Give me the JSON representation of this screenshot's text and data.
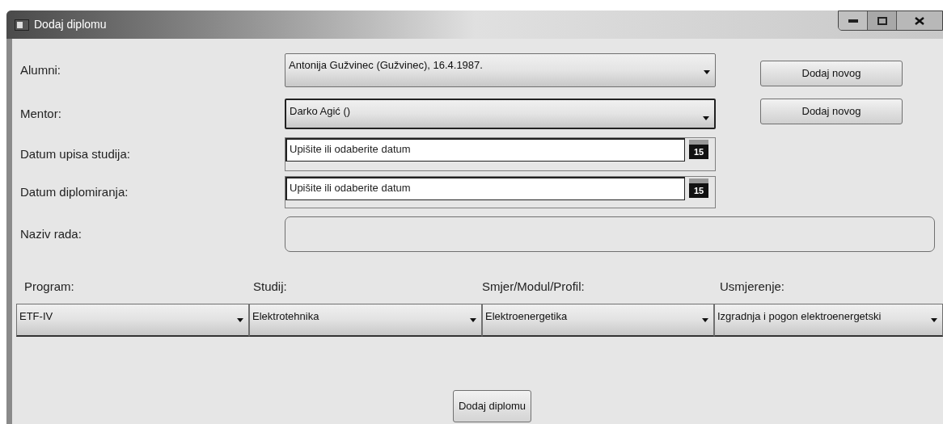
{
  "window": {
    "title": "Dodaj diplomu"
  },
  "fields": [
    {
      "kind": "combo",
      "label": "Alumni:",
      "value": "Antonija Gužvinec (Gužvinec), 16.4.1987.",
      "focused": false,
      "add_button": "Dodaj novog"
    },
    {
      "kind": "combo",
      "label": "Mentor:",
      "value": "Darko Agić ()",
      "focused": true,
      "add_button": "Dodaj novog"
    },
    {
      "kind": "date",
      "label": "Datum upisa studija:",
      "placeholder": "Upišite ili odaberite datum",
      "calendar_day": "15"
    },
    {
      "kind": "date",
      "label": "Datum diplomiranja:",
      "placeholder": "Upišite ili odaberite datum",
      "calendar_day": "15"
    },
    {
      "kind": "textbox",
      "label": "Naziv rada:"
    }
  ],
  "selectors": [
    {
      "label": "Program:",
      "value": "ETF-IV"
    },
    {
      "label": "Studij:",
      "value": "Elektrotehnika"
    },
    {
      "label": "Smjer/Modul/Profil:",
      "value": "Elektroenergetika"
    },
    {
      "label": "Usmjerenje:",
      "value": "Izgradnja i pogon elektroenergetski"
    }
  ],
  "submit_button": "Dodaj diplomu"
}
